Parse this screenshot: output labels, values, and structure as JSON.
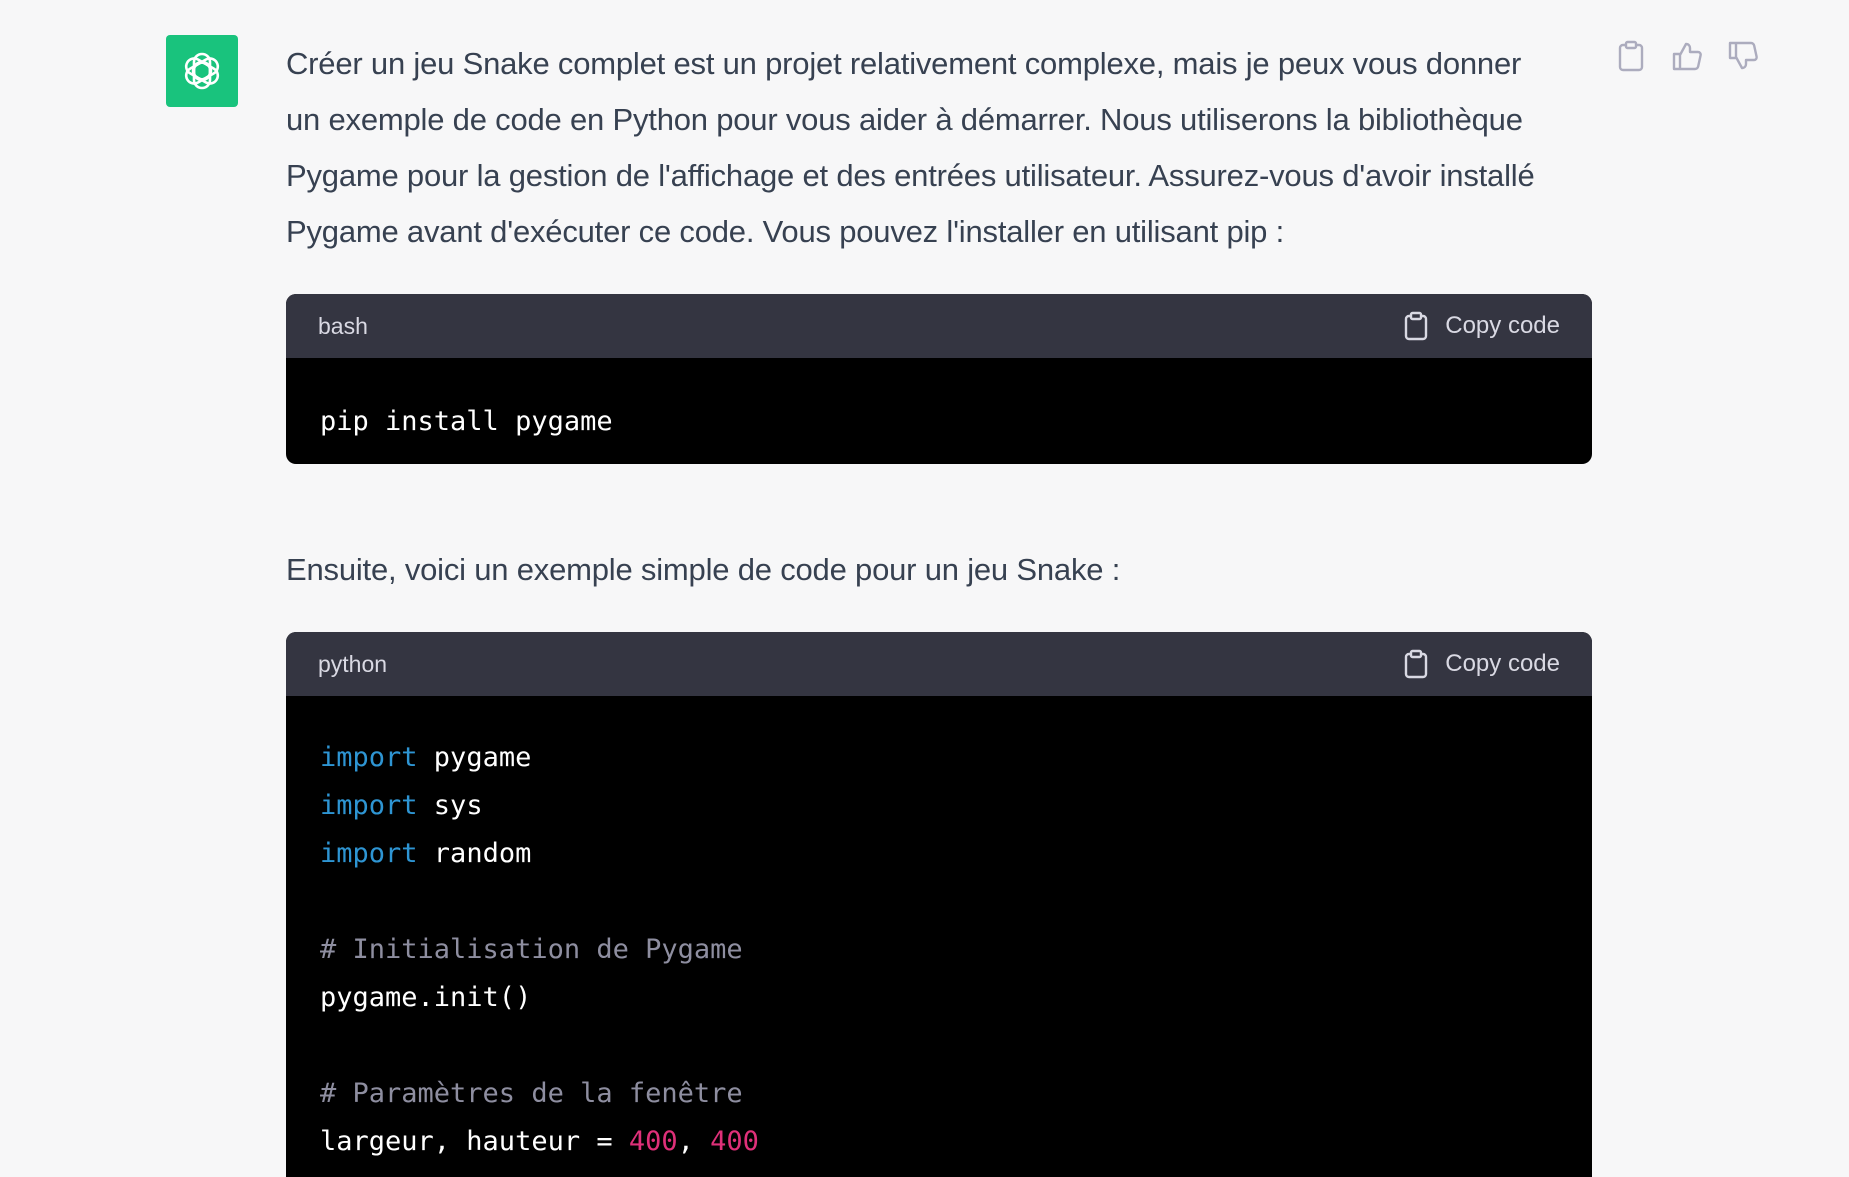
{
  "assistant": {
    "avatar_icon": "openai-logo-icon",
    "avatar_color": "#19c37d"
  },
  "actions": {
    "copy_icon": "clipboard-icon",
    "thumbs_up_icon": "thumbs-up-icon",
    "thumbs_down_icon": "thumbs-down-icon"
  },
  "message": {
    "intro_lines": [
      "Créer un jeu Snake complet est un projet relativement complexe, mais je peux vous donner",
      "un exemple de code en Python pour vous aider à démarrer. Nous utiliserons la bibliothèque",
      "Pygame pour la gestion de l'affichage et des entrées utilisateur. Assurez-vous d'avoir installé",
      "Pygame avant d'exécuter ce code. Vous pouvez l'installer en utilisant pip :"
    ],
    "followup": "Ensuite, voici un exemple simple de code pour un jeu Snake :"
  },
  "code_blocks": [
    {
      "language": "bash",
      "copy_label": "Copy code",
      "lines": [
        [
          {
            "t": "pip install pygame",
            "c": "plain"
          }
        ]
      ]
    },
    {
      "language": "python",
      "copy_label": "Copy code",
      "lines": [
        [
          {
            "t": "import",
            "c": "kw"
          },
          {
            "t": " pygame",
            "c": "plain"
          }
        ],
        [
          {
            "t": "import",
            "c": "kw"
          },
          {
            "t": " sys",
            "c": "plain"
          }
        ],
        [
          {
            "t": "import",
            "c": "kw"
          },
          {
            "t": " random",
            "c": "plain"
          }
        ],
        [],
        [
          {
            "t": "# Initialisation de Pygame",
            "c": "cm"
          }
        ],
        [
          {
            "t": "pygame.init()",
            "c": "plain"
          }
        ],
        [],
        [
          {
            "t": "# Paramètres de la fenêtre",
            "c": "cm"
          }
        ],
        [
          {
            "t": "largeur, hauteur = ",
            "c": "plain"
          },
          {
            "t": "400",
            "c": "num"
          },
          {
            "t": ", ",
            "c": "plain"
          },
          {
            "t": "400",
            "c": "num"
          }
        ]
      ]
    }
  ],
  "colors": {
    "page_bg": "#f7f7f8",
    "text": "#374151",
    "code_header_bg": "#343541",
    "code_bg": "#000000",
    "keyword": "#2e95d3",
    "comment": "#8e8ea0",
    "number": "#df3079"
  }
}
